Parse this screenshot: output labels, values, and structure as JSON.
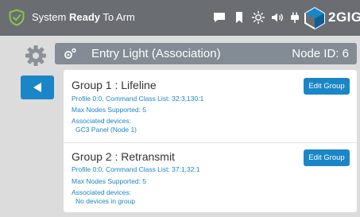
{
  "status_bar": {
    "text_prefix": "System ",
    "text_bold": "Ready",
    "text_suffix": " To Arm",
    "brand": "2GIG",
    "icons": [
      "shield-check-icon",
      "message-icon",
      "bookmark-icon",
      "brightness-icon",
      "volume-icon",
      "plug-icon",
      "brand-logo-icon"
    ],
    "accent_color": "#8bc34a"
  },
  "header": {
    "title": "Entry Light (Association)",
    "node_id": "Node ID: 6"
  },
  "groups": [
    {
      "title": "Group 1 : Lifeline",
      "profile": "Profile 0:0, Command Class List: 32:3,130:1",
      "max_nodes": "Max Nodes Supported: 5",
      "assoc_label": "Associated devices:",
      "device": "GC3 Panel (Node 1)",
      "edit_label": "Edit Group"
    },
    {
      "title": "Group 2 : Retransmit",
      "profile": "Profile 0:0, Command Class List: 37:1,32:1",
      "max_nodes": "Max Nodes Supported: 5",
      "assoc_label": "Associated devices:",
      "device": "No devices in group",
      "edit_label": "Edit Group"
    }
  ],
  "colors": {
    "primary_blue": "#1a86c8",
    "status_bar_bg": "#6a6d72",
    "header_bg": "#838c94"
  }
}
